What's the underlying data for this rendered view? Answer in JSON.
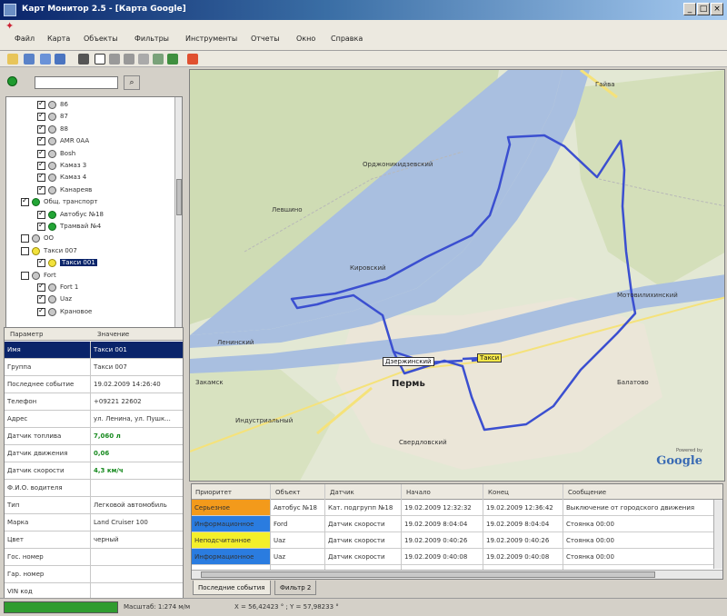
{
  "window": {
    "title": "Карт Монитор 2.5 - [Карта Google]",
    "buttons": [
      "_",
      "□",
      "×"
    ]
  },
  "menu": [
    "Файл",
    "Карта",
    "Объекты",
    "Фильтры",
    "Инструменты",
    "Отчеты",
    "Окно",
    "Справка"
  ],
  "toolbar": {
    "icons": [
      "open-icon",
      "save-icon",
      "print-icon",
      "back-icon",
      "pointer-icon",
      "select-icon",
      "zoom-in-icon",
      "zoom-out-icon",
      "pan-icon",
      "refresh-icon",
      "layers-icon",
      "stop-icon"
    ]
  },
  "object_tree": {
    "items": [
      {
        "label": "86",
        "checked": true,
        "icon": "grey"
      },
      {
        "label": "87",
        "checked": true,
        "icon": "grey"
      },
      {
        "label": "88",
        "checked": true,
        "icon": "grey"
      },
      {
        "label": "AMR 0AA",
        "checked": true,
        "icon": "grey"
      },
      {
        "label": "Bosh",
        "checked": true,
        "icon": "grey"
      },
      {
        "label": "Камаз 3",
        "checked": true,
        "icon": "grey"
      },
      {
        "label": "Камаз 4",
        "checked": true,
        "icon": "grey"
      },
      {
        "label": "Канареяв",
        "checked": true,
        "icon": "grey"
      },
      {
        "label": "Общ. транспорт",
        "checked": true,
        "icon": "green"
      },
      {
        "label": "Автобус №18",
        "checked": true,
        "icon": "green"
      },
      {
        "label": "Трамвай №4",
        "checked": true,
        "icon": "green"
      },
      {
        "label": "ОО",
        "checked": false,
        "icon": "grey"
      },
      {
        "label": "Такси 007",
        "checked": false,
        "icon": "yellow"
      },
      {
        "label": "Такси 001",
        "checked": true,
        "icon": "yellow",
        "selected": true
      },
      {
        "label": "Fort",
        "checked": false,
        "icon": "grey"
      },
      {
        "label": "Fort 1",
        "checked": true,
        "icon": "grey"
      },
      {
        "label": "Uaz",
        "checked": true,
        "icon": "grey"
      },
      {
        "label": "Крановое",
        "checked": true,
        "icon": "grey"
      }
    ]
  },
  "properties": {
    "headers": [
      "Параметр",
      "Значение"
    ],
    "rows": [
      {
        "key": "Имя",
        "value": "Такси 001",
        "selected": true
      },
      {
        "key": "Группа",
        "value": "Такси 007"
      },
      {
        "key": "Последнее событие",
        "value": "19.02.2009 14:26:40"
      },
      {
        "key": "Телефон",
        "value": "+09221 22602"
      },
      {
        "key": "Адрес",
        "value": "ул. Ленина, ул. Пушк..."
      },
      {
        "key": "Датчик топлива",
        "value": "7,060 л",
        "green": true
      },
      {
        "key": "Датчик движения",
        "value": "0,06",
        "green": true
      },
      {
        "key": "Датчик скорости",
        "value": "4,3 км/ч",
        "green": true
      },
      {
        "key": "Ф.И.О. водителя",
        "value": ""
      },
      {
        "key": "Тип",
        "value": "Легковой автомобиль"
      },
      {
        "key": "Марка",
        "value": "Land Cruiser 100"
      },
      {
        "key": "Цвет",
        "value": "черный"
      },
      {
        "key": "Гос. номер",
        "value": ""
      },
      {
        "key": "Гар. номер",
        "value": ""
      },
      {
        "key": "VIN код",
        "value": ""
      }
    ]
  },
  "map": {
    "city_label": "Пермь",
    "labels": [
      "Кировский",
      "Гайва",
      "Мотовилихинский",
      "Ленинский",
      "Индустриальный",
      "Свердловский",
      "Орджоникидзевский",
      "Закамск",
      "Балатово",
      "Левшино"
    ],
    "tags": [
      {
        "text": "Дзержинский",
        "style": "white"
      },
      {
        "text": "Такси",
        "style": "yellow"
      }
    ],
    "powered_by": "Powered by",
    "google": "Google",
    "route_color": "#3b4fd0"
  },
  "events": {
    "headers": [
      "Приоритет",
      "Объект",
      "Датчик",
      "Начало",
      "Конец",
      "Сообщение"
    ],
    "rows": [
      {
        "priority": "Серьезное",
        "color": "#f39a1b",
        "object": "Автобус №18",
        "sensor": "Кат. подгрупп №18",
        "start": "19.02.2009 12:32:32",
        "end": "19.02.2009 12:36:42",
        "message": "Выключение от городского движения"
      },
      {
        "priority": "Информационное",
        "color": "#2a7ce0",
        "object": "Ford",
        "sensor": "Датчик скорости",
        "start": "19.02.2009 8:04:04",
        "end": "19.02.2009 8:04:04",
        "message": "Стоянка 00:00"
      },
      {
        "priority": "Неподсчитанное",
        "color": "#f4ef2a",
        "object": "Uaz",
        "sensor": "Датчик скорости",
        "start": "19.02.2009 0:40:26",
        "end": "19.02.2009 0:40:26",
        "message": "Стоянка 00:00"
      },
      {
        "priority": "Информационное",
        "color": "#2a7ce0",
        "object": "Uaz",
        "sensor": "Датчик скорости",
        "start": "19.02.2009 0:40:08",
        "end": "19.02.2009 0:40:08",
        "message": "Стоянка 00:00"
      }
    ]
  },
  "tabs": [
    "Последние события",
    "Фильтр 2"
  ],
  "status": {
    "scale": "Масштаб: 1:274 м/м",
    "coords": "X = 56,42423 ° ; Y = 57,98233 °"
  }
}
